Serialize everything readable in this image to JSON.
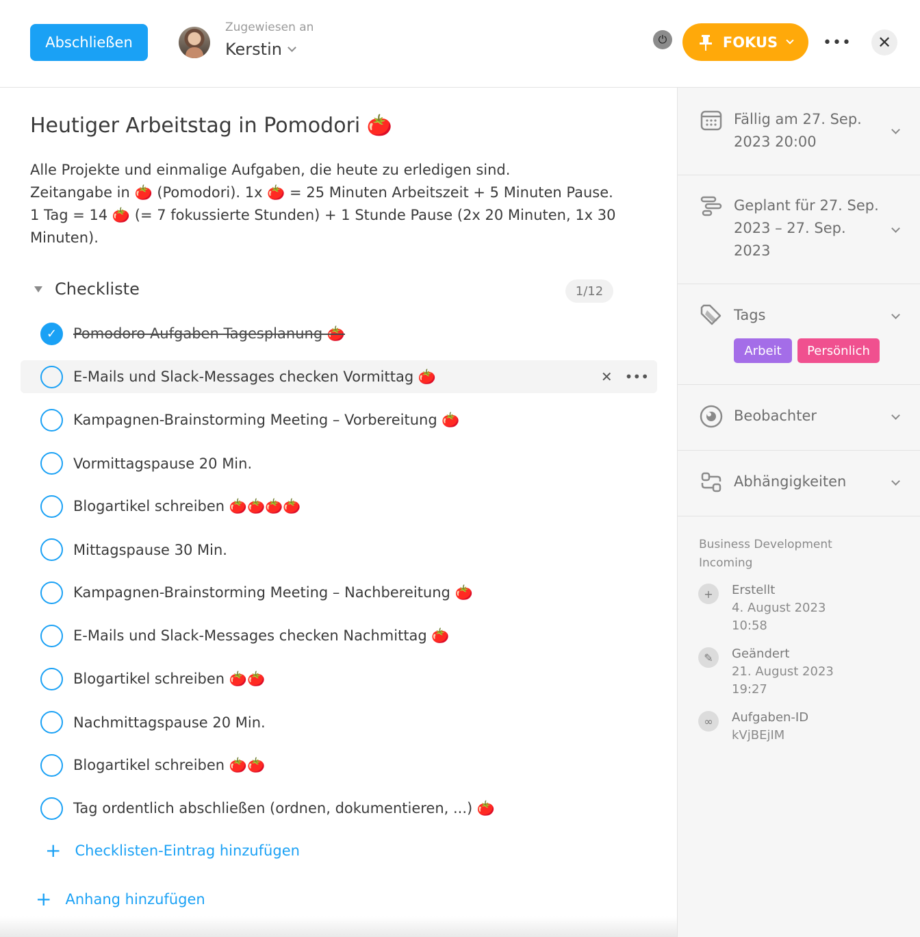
{
  "header": {
    "complete_label": "Abschließen",
    "assigned_label": "Zugewiesen an",
    "assignee": "Kerstin",
    "focus_label": "FOKUS"
  },
  "task": {
    "title": "Heutiger Arbeitstag in Pomodori 🍅",
    "description": [
      "Alle Projekte und einmalige Aufgaben, die heute zu erledigen sind.",
      "Zeitangabe in 🍅 (Pomodori). 1x 🍅 = 25 Minuten Arbeitszeit + 5 Minuten Pause.",
      "1 Tag = 14 🍅 (= 7 fokussierte Stunden) + 1 Stunde Pause (2x 20 Minuten, 1x 30 Minuten)."
    ]
  },
  "checklist": {
    "title": "Checkliste",
    "count": "1/12",
    "items": [
      {
        "text": "Pomodoro Aufgaben Tagesplanung 🍅",
        "done": true
      },
      {
        "text": "E-Mails und Slack-Messages checken Vormittag 🍅",
        "done": false
      },
      {
        "text": "Kampagnen-Brainstorming Meeting – Vorbereitung 🍅",
        "done": false
      },
      {
        "text": "Vormittagspause 20 Min.",
        "done": false
      },
      {
        "text": "Blogartikel schreiben 🍅🍅🍅🍅",
        "done": false
      },
      {
        "text": "Mittagspause 30 Min.",
        "done": false
      },
      {
        "text": "Kampagnen-Brainstorming Meeting – Nachbereitung 🍅",
        "done": false
      },
      {
        "text": "E-Mails und Slack-Messages checken Nachmittag 🍅",
        "done": false
      },
      {
        "text": "Blogartikel schreiben 🍅🍅",
        "done": false
      },
      {
        "text": "Nachmittagspause 20 Min.",
        "done": false
      },
      {
        "text": "Blogartikel schreiben 🍅🍅",
        "done": false
      },
      {
        "text": "Tag ordentlich abschließen (ordnen, dokumentieren, ...) 🍅",
        "done": false
      }
    ],
    "add_label": "Checklisten-Eintrag hinzufügen"
  },
  "attachment": {
    "add_label": "Anhang hinzufügen"
  },
  "sidebar": {
    "due": {
      "line1": "Fällig am 27. Sep.",
      "line2": "2023 20:00"
    },
    "planned": {
      "line1": "Geplant für 27. Sep.",
      "line2": "2023 – 27. Sep.",
      "line3": "2023"
    },
    "tags": {
      "label": "Tags",
      "items": [
        {
          "label": "Arbeit",
          "color": "#a46de8"
        },
        {
          "label": "Persönlich",
          "color": "#f0508f"
        }
      ]
    },
    "watchers": {
      "label": "Beobachter"
    },
    "dependencies": {
      "label": "Abhängigkeiten"
    },
    "project": {
      "name": "Business Development",
      "section": "Incoming"
    },
    "created": {
      "label": "Erstellt",
      "date": "4. August 2023",
      "time": "10:58"
    },
    "modified": {
      "label": "Geändert",
      "date": "21. August 2023",
      "time": "19:27"
    },
    "task_id": {
      "label": "Aufgaben-ID",
      "value": "kVjBEjIM"
    }
  },
  "colors": {
    "accent": "#1aa1f5",
    "focus": "#ffa90a"
  }
}
